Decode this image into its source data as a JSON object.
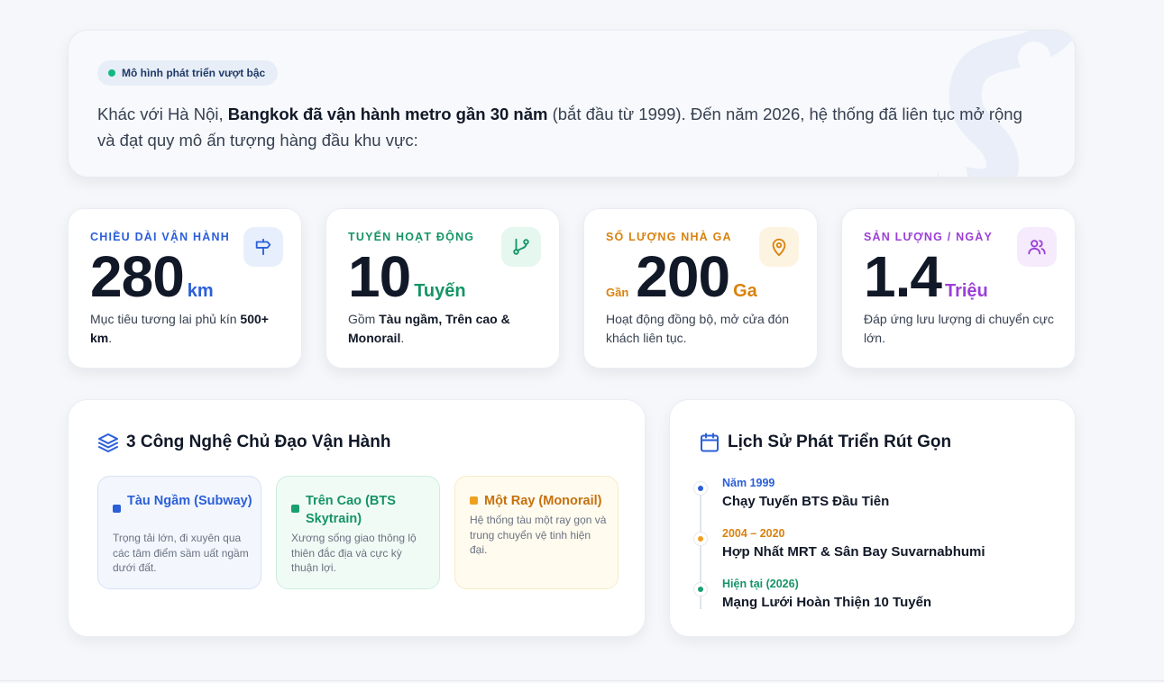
{
  "hero": {
    "badge": "Mô hình phát triển vượt bậc",
    "text_prefix": "Khác với Hà Nội, ",
    "text_bold": "Bangkok đã vận hành metro gần 30 năm",
    "text_suffix": " (bắt đầu từ 1999). Đến năm 2026, hệ thống đã liên tục mở rộng và đạt quy mô ấn tượng hàng đầu khu vực:"
  },
  "stats": [
    {
      "label": "CHIỀU DÀI VẬN HÀNH",
      "prefix": "",
      "value": "280",
      "unit": "km",
      "color": "#2b5fd9",
      "icon_bg": "#e8effc",
      "icon": "signpost-icon",
      "desc_before": "Mục tiêu tương lai phủ kín ",
      "desc_bold": "500+ km",
      "desc_after": "."
    },
    {
      "label": "TUYẾN HOẠT ĐỘNG",
      "prefix": "",
      "value": "10",
      "unit": "Tuyến",
      "color": "#159466",
      "icon_bg": "#e6f7ef",
      "icon": "git-branch-icon",
      "desc_before": "Gồm ",
      "desc_bold": "Tàu ngầm, Trên cao & Monorail",
      "desc_after": "."
    },
    {
      "label": "SỐ LƯỢNG NHÀ GA",
      "prefix": "Gần",
      "value": "200",
      "unit": "Ga",
      "color": "#d9820f",
      "icon_bg": "#fdf3e1",
      "icon": "map-pin-icon",
      "desc_before": "Hoạt động đồng bộ, mở cửa đón khách liên tục.",
      "desc_bold": "",
      "desc_after": ""
    },
    {
      "label": "SẢN LƯỢNG / NGÀY",
      "prefix": "",
      "value": "1.4",
      "unit": "Triệu",
      "color": "#9b3fd6",
      "icon_bg": "#f5ebfc",
      "icon": "users-icon",
      "desc_before": "Đáp ứng lưu lượng di chuyển cực lớn.",
      "desc_bold": "",
      "desc_after": ""
    }
  ],
  "tech_panel": {
    "title": "3 Công Nghệ Chủ Đạo Vận Hành",
    "icon": "layers-icon",
    "items": [
      {
        "name": "Tàu Ngầm (Subway)",
        "desc": "Trọng tải lớn, đi xuyên qua các tâm điểm sầm uất ngầm dưới đất.",
        "color": "#2b5fd9",
        "dot": "#2b5fd9"
      },
      {
        "name": "Trên Cao (BTS Skytrain)",
        "desc": "Xương sống giao thông lộ thiên đắc địa và cực kỳ thuận lợi.",
        "color": "#159466",
        "dot": "#19a06f"
      },
      {
        "name": "Một Ray (Monorail)",
        "desc": "Hệ thống tàu một ray gọn và trung chuyển vệ tinh hiện đại.",
        "color": "#c7700c",
        "dot": "#f0a01f"
      }
    ]
  },
  "history_panel": {
    "title": "Lịch Sử Phát Triển Rút Gọn",
    "icon": "calendar-icon",
    "items": [
      {
        "date": "Năm 1999",
        "event": "Chạy Tuyến BTS Đầu Tiên",
        "color": "#2b5fd9"
      },
      {
        "date": "2004 – 2020",
        "event": "Hợp Nhất MRT & Sân Bay Suvarnabhumi",
        "color": "#d9820f"
      },
      {
        "date": "Hiện tại (2026)",
        "event": "Mạng Lưới Hoàn Thiện 10 Tuyến",
        "color": "#159466"
      }
    ]
  }
}
